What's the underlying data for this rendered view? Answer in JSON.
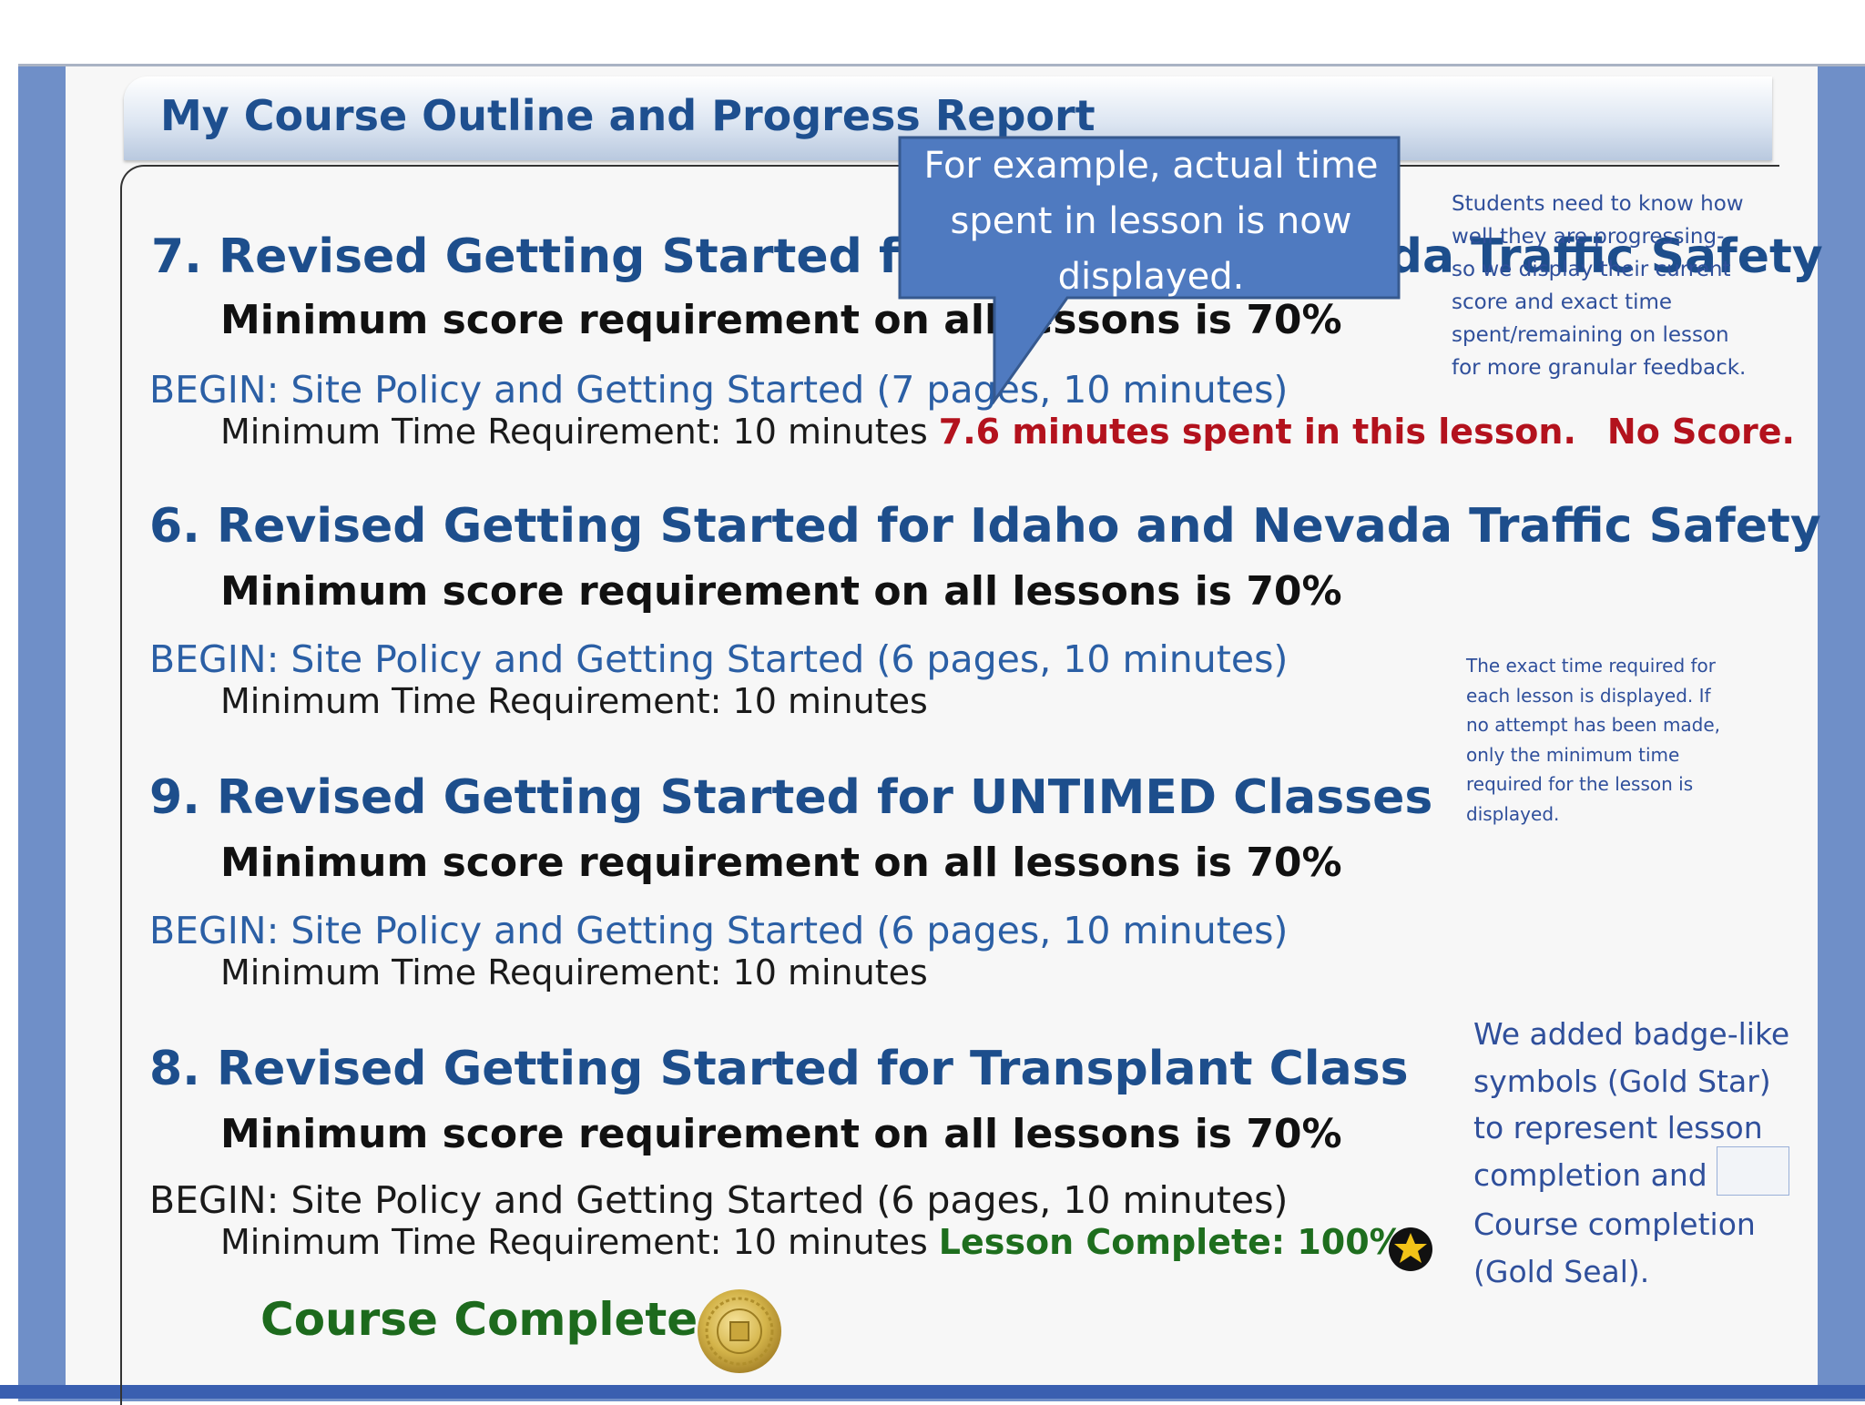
{
  "header": {
    "title": "My Course Outline and Progress Report"
  },
  "courses": [
    {
      "title": "7. Revised Getting Started for Idaho and Nevada Traffic Safety",
      "min_score": "Minimum score requirement on all lessons is 70%",
      "begin": "BEGIN: Site Policy and Getting Started (7 pages, 10 minutes)",
      "min_time": "Minimum Time Requirement: 10 minutes",
      "time_spent": "7.6 minutes spent in this lesson.",
      "score": "No Score."
    },
    {
      "title": "6. Revised Getting Started for Idaho and Nevada Traffic Safety",
      "min_score": "Minimum score requirement on all lessons is 70%",
      "begin": "BEGIN: Site Policy and Getting Started (6 pages, 10 minutes)",
      "min_time": "Minimum Time Requirement: 10 minutes"
    },
    {
      "title": "9. Revised Getting Started for UNTIMED Classes",
      "min_score": "Minimum score requirement on all lessons is 70%",
      "begin": "BEGIN: Site Policy and Getting Started (6 pages, 10 minutes)",
      "min_time": "Minimum Time Requirement: 10 minutes"
    },
    {
      "title": "8. Revised Getting Started for Transplant Class",
      "min_score": "Minimum score requirement on all lessons is 70%",
      "begin": "BEGIN: Site Policy and Getting Started (6 pages, 10 minutes)",
      "min_time": "Minimum Time Requirement: 10 minutes",
      "status": "Lesson Complete: 100%"
    }
  ],
  "course_completed": "Course Completed",
  "callout": {
    "text": "For example, actual time spent in lesson is now displayed."
  },
  "notes": {
    "progress": "Students need to know how well they are progressing- so we display their current score and exact time spent/remaining on lesson for more granular feedback.",
    "time_required": "The exact time required for each lesson is displayed. If no attempt has been made, only the minimum time required for the lesson is displayed.",
    "badges_1": "We added badge-like symbols (Gold Star) to represent lesson completion and",
    "badges_2": "Course completion (Gold Seal)."
  },
  "colors": {
    "title_blue": "#1d4e8c",
    "alert_red": "#b3121d",
    "complete_green": "#1e6e1e",
    "callout_blue": "#4f7ac0",
    "gold": "#d4b44a"
  },
  "icons": {
    "star": "gold-star-icon",
    "seal": "gold-seal-icon"
  }
}
